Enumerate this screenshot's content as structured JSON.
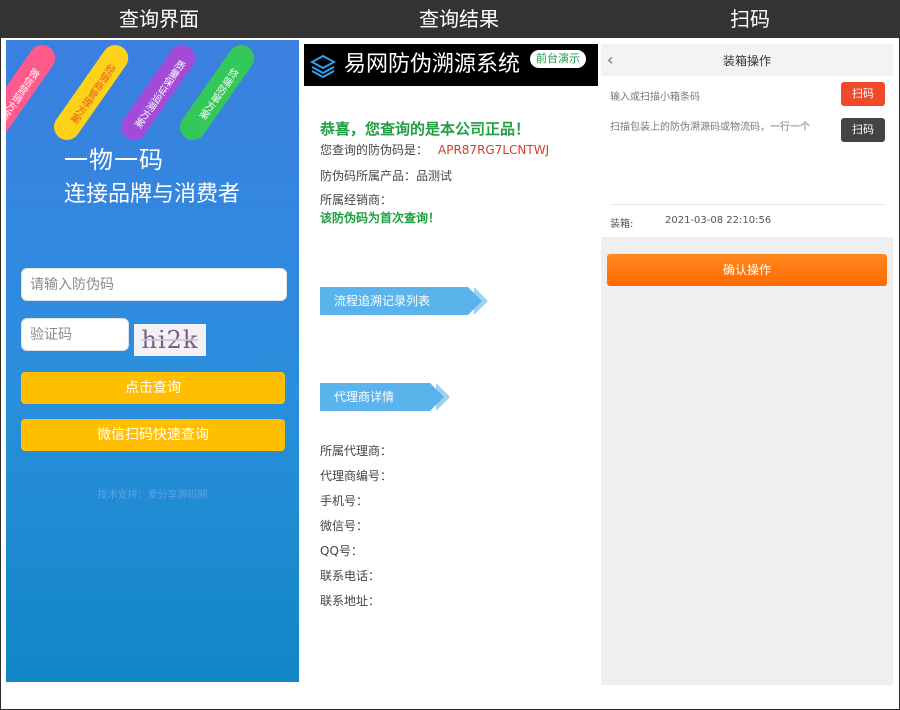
{
  "headers": {
    "left": "查询界面",
    "middle": "查询结果",
    "right": "扫码"
  },
  "panel1": {
    "ribbons": [
      "微信营销方案",
      "经销商管理方案",
      "质量保证追溯方案",
      "终端防窜方案"
    ],
    "slogan": {
      "line1": "一物一码",
      "line2": "连接品牌与消费者"
    },
    "code_input": {
      "placeholder": "请输入防伪码"
    },
    "captcha_input": {
      "placeholder": "验证码"
    },
    "captcha_text": "hi2k",
    "query_button": "点击查询",
    "wechat_button": "微信扫码快速查询",
    "footer": "技术支持：爱分享源码网"
  },
  "panel2": {
    "brand": {
      "name": "易网防伪溯源系统",
      "demo_badge": "前台演示"
    },
    "congrats": "恭喜，您查询的是本公司正品！",
    "code_label": "您查询的防伪码是：",
    "code_value": "APR87RG7LCNTWJ",
    "product_label": "防伪码所属产品：",
    "product_value": "品测试",
    "dealer_label": "所属经销商：",
    "first_query": "该防伪码为首次查询！",
    "section1": "流程追溯记录列表",
    "section2": "代理商详情",
    "agent_fields": [
      "所属代理商：",
      "代理商编号：",
      "手机号：",
      "微信号：",
      "QQ号：",
      "联系电话：",
      "联系地址："
    ]
  },
  "panel3": {
    "title": "装箱操作",
    "box_hint": "输入或扫描小箱条码",
    "scan_red": "扫码",
    "trace_hint": "扫描包装上的防伪溯源码或物流码，一行一个",
    "scan_dark": "扫码",
    "box_label": "装箱:",
    "box_time": "2021-03-08 22:10:56",
    "confirm": "确认操作"
  },
  "colors": {
    "accent_yellow": "#ffbf00",
    "accent_orange": "#ff6a00",
    "success_green": "#1fa041",
    "code_red": "#d43c2f",
    "section_blue": "#5ab3ea"
  }
}
